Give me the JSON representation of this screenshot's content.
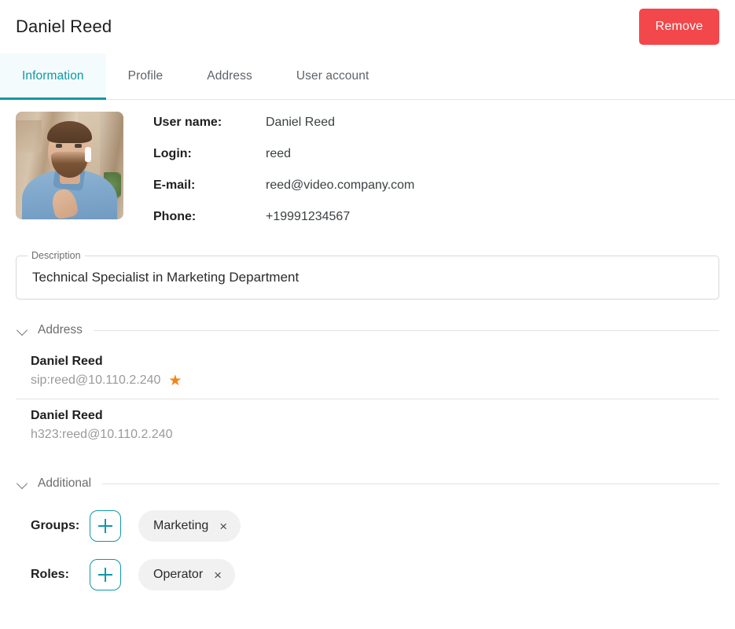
{
  "header": {
    "title": "Daniel Reed",
    "remove_label": "Remove"
  },
  "tabs": [
    {
      "label": "Information",
      "active": true
    },
    {
      "label": "Profile",
      "active": false
    },
    {
      "label": "Address",
      "active": false
    },
    {
      "label": "User account",
      "active": false
    }
  ],
  "avatar": {
    "icon": "user-photo",
    "alt": "Photo of Daniel Reed wearing a blue shirt with wireless earbuds"
  },
  "info_fields": [
    {
      "label": "User name:",
      "value": "Daniel Reed"
    },
    {
      "label": "Login:",
      "value": "reed"
    },
    {
      "label": "E-mail:",
      "value": "reed@video.company.com"
    },
    {
      "label": "Phone:",
      "value": "+19991234567"
    }
  ],
  "description": {
    "legend": "Description",
    "value": "Technical Specialist in Marketing Department",
    "placeholder": "Description"
  },
  "address_section": {
    "title": "Address",
    "chevron": "chevron-down-icon",
    "items": [
      {
        "name": "Daniel Reed",
        "uri": "sip:reed@10.110.2.240",
        "starred": true,
        "star_icon": "star-icon"
      },
      {
        "name": "Daniel Reed",
        "uri": "h323:reed@10.110.2.240",
        "starred": false,
        "star_icon": ""
      }
    ]
  },
  "additional_section": {
    "title": "Additional",
    "chevron": "chevron-down-icon",
    "rows": [
      {
        "label": "Groups:",
        "add_icon": "plus-icon",
        "chips": [
          {
            "text": "Marketing",
            "remove_icon": "×"
          }
        ]
      },
      {
        "label": "Roles:",
        "add_icon": "plus-icon",
        "chips": [
          {
            "text": "Operator",
            "remove_icon": "×"
          }
        ]
      }
    ]
  },
  "colors": {
    "accent_teal": "#0e98a6",
    "danger_red": "#f2484b",
    "star_orange": "#f28419",
    "chip_bg": "#f1f1f1",
    "text_primary": "#1f1f1f",
    "text_muted": "#9a9a9a",
    "divider": "#e2e2e2"
  }
}
